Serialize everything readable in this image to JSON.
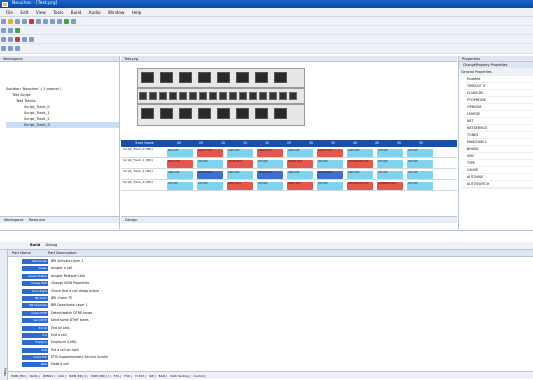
{
  "window": {
    "title": "Neuchec - [Test.prg]"
  },
  "menu": [
    "File",
    "Edit",
    "View",
    "Tools",
    "Build",
    "Audio",
    "Window",
    "Help"
  ],
  "workspace": {
    "title": "Workspace",
    "tree": [
      "Solution 'Neuchec' ( 1 project )",
      "Test Script",
      "Test Tracks",
      "Script_Track_0",
      "Script_Track_1",
      "Script_Track_2",
      "Script_Track_3"
    ],
    "tabs": [
      "Workspace",
      "Resource"
    ]
  },
  "editor": {
    "tab": "Test.prg",
    "bottom_tab": "Design",
    "header_cells": [
      "Track Name",
      "00",
      "05",
      "10",
      "15",
      "20",
      "25",
      "30",
      "35",
      "40",
      "45",
      "50",
      "55"
    ],
    "rows": [
      {
        "name": "Script_Track_0",
        "type": "[PRI]",
        "pills": [
          [
            "MG",
            "DAT"
          ],
          [
            "START",
            "DAT"
          ],
          [
            "ANS",
            "DAT"
          ],
          [
            "START",
            "DAT"
          ],
          [
            "ANS",
            "DAT"
          ],
          [
            "START",
            "DAT"
          ],
          [
            "ANS",
            "DAT"
          ],
          [
            "UP",
            "DAT"
          ],
          [
            "UP",
            "DAT"
          ]
        ]
      },
      {
        "name": "Script_Track_1",
        "type": "[PRI]",
        "pills": [
          [
            "ORG",
            "DAT"
          ],
          [
            "UP",
            "DAT"
          ],
          [
            "START",
            "DAT"
          ],
          [
            "UP",
            "DAT"
          ],
          [
            "START",
            "DAT"
          ],
          [
            "UP",
            "DAT"
          ],
          [
            "ORIGINATE",
            "DAT"
          ],
          [
            "UP",
            "DAT"
          ],
          [
            "UP",
            "DAT"
          ]
        ]
      },
      {
        "name": "Script_Track_2",
        "type": "[PRI]",
        "pills": [
          [
            "ANS",
            "DAT"
          ],
          [
            "START",
            "DAT"
          ],
          [
            "ANS",
            "DAT"
          ],
          [
            "START",
            "DAT"
          ],
          [
            "ANS",
            "DAT"
          ],
          [
            "START",
            "DAT"
          ],
          [
            "ANS",
            "DAT"
          ],
          [
            "UP",
            "DAT"
          ],
          [
            "UP",
            "DAT"
          ]
        ]
      },
      {
        "name": "Script_Track_3",
        "type": "[PRI]",
        "pills": [
          [
            "UP",
            "DAT"
          ],
          [
            "UP",
            "DAT"
          ],
          [
            "ORIG",
            "DAT"
          ],
          [
            "UP",
            "DAT"
          ],
          [
            "ORIG",
            "DAT"
          ],
          [
            "UP",
            "DAT"
          ],
          [
            "ORIGINATE",
            "DAT"
          ],
          [
            "ANSWER",
            "DAT"
          ],
          [
            "UP",
            "DAT"
          ]
        ]
      }
    ]
  },
  "properties": {
    "title": "Properties",
    "header": "ChangeProperty Properties",
    "group": "General Properties",
    "items": [
      [
        "Enabled",
        ""
      ],
      [
        "TIMEOUT",
        "0"
      ],
      [
        "CLIARCDE",
        ""
      ],
      [
        "PTOPMODE",
        ""
      ],
      [
        "OPMODE",
        ""
      ],
      [
        "LEHEDE",
        ""
      ],
      [
        "NET",
        ""
      ],
      [
        "NETSERVICE",
        ""
      ],
      [
        "TONES",
        ""
      ],
      [
        "MAXCHAN",
        "2"
      ],
      [
        "BHADE",
        ""
      ],
      [
        "SMC",
        ""
      ],
      [
        "TYPE",
        ""
      ],
      [
        "CAUSE",
        ""
      ],
      [
        "AUTOANS",
        ""
      ],
      [
        "AUTOSWITCH",
        ""
      ]
    ]
  },
  "output": {
    "tabs": [
      "Build",
      "Debug"
    ]
  },
  "parts": {
    "col_name": "Part Name",
    "col_desc": "Part Description",
    "items": [
      [
        "BRI Activate",
        "BRI Activate Layer 1"
      ],
      [
        "Answer",
        "Answer a call"
      ],
      [
        "Answer Multiple",
        "Answer Multiple Calls"
      ],
      [
        "Change ISDN",
        "Change ISDN Properties"
      ],
      [
        "Check Digits",
        "Check that a call dialgs active"
      ],
      [
        "BRI Check",
        "BRI Check TE"
      ],
      [
        "BRI Deactivate",
        "BRI Deactivate Layer 1"
      ],
      [
        "Detect DTMF",
        "Detect/watch DTMF tones"
      ],
      [
        "Send DTMF",
        "Send some DTMF tones"
      ],
      [
        "End All",
        "End all calls"
      ],
      [
        "End",
        "End a call"
      ],
      [
        "Emptycm",
        "Emptycm (LMD)"
      ],
      [
        "Hold",
        "Put a call on hold"
      ],
      [
        "Invoke ETSI",
        "ETSI Supplementary Service Invoke"
      ],
      [
        "Make",
        "Make a call"
      ]
    ],
    "tabs": [
      "ISDN_PRI",
      "DASS",
      "DPNSS",
      "CAS",
      "ISDN_BRI_S",
      "ISDN_BRI_U",
      "FXS",
      "FXO",
      "H.323",
      "SIP",
      "E&M",
      "Path Testing",
      "Control"
    ]
  },
  "side_label": "Parts"
}
